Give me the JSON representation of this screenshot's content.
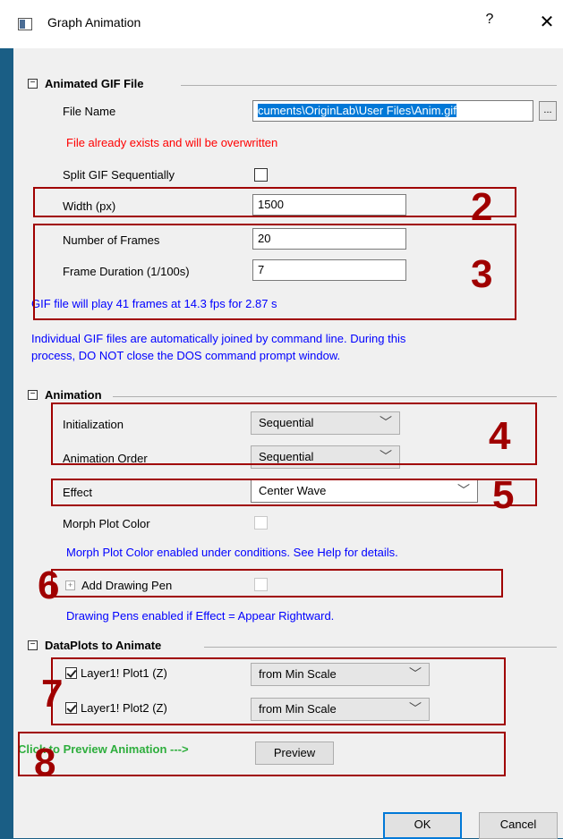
{
  "window": {
    "title": "Graph Animation",
    "help_glyph": "?",
    "close_glyph": "✕"
  },
  "gif_section": {
    "toggle": "−",
    "title": "Animated GIF File",
    "file_name_label": "File Name",
    "file_name_value": "cuments\\OriginLab\\User Files\\Anim.gif",
    "browse_label": "...",
    "overwrite_warning": "File already exists and will be overwritten",
    "split_label": "Split GIF Sequentially",
    "split_checked": false,
    "width_label": "Width (px)",
    "width_value": "1500",
    "frames_label": "Number of Frames",
    "frames_value": "20",
    "duration_label": "Frame Duration (1/100s)",
    "duration_value": "7",
    "play_info": "GIF file will play 41 frames at 14.3 fps for 2.87 s",
    "note_line1": "Individual GIF files are automatically joined by command line. During this",
    "note_line2": "process, DO NOT close the DOS command prompt window."
  },
  "animation_section": {
    "toggle": "−",
    "title": "Animation",
    "init_label": "Initialization",
    "init_value": "Sequential",
    "order_label": "Animation Order",
    "order_value": "Sequential",
    "effect_label": "Effect",
    "effect_value": "Center Wave",
    "morph_label": "Morph Plot Color",
    "morph_note": "Morph Plot Color enabled under conditions. See Help for details.",
    "pen_expand": "+",
    "pen_label": "Add Drawing Pen",
    "pen_note": "Drawing Pens enabled if Effect = Appear Rightward."
  },
  "dataplots_section": {
    "toggle": "−",
    "title": "DataPlots to Animate",
    "plots": [
      {
        "label": "Layer1! Plot1 (Z)",
        "checked": true,
        "scale": "from  Min Scale"
      },
      {
        "label": "Layer1! Plot2 (Z)",
        "checked": true,
        "scale": "from  Min Scale"
      }
    ]
  },
  "preview": {
    "hint": "Click to Preview Animation   --->",
    "button": "Preview"
  },
  "footer": {
    "ok": "OK",
    "cancel": "Cancel"
  },
  "annotations": [
    "2",
    "3",
    "4",
    "5",
    "6",
    "7",
    "8"
  ],
  "colors": {
    "annotation": "#a00000",
    "warning": "#ff0000",
    "info": "#0000ff",
    "preview_hint": "#2eae3d",
    "selection": "#0078d7"
  },
  "chevron_glyph": "﹀"
}
